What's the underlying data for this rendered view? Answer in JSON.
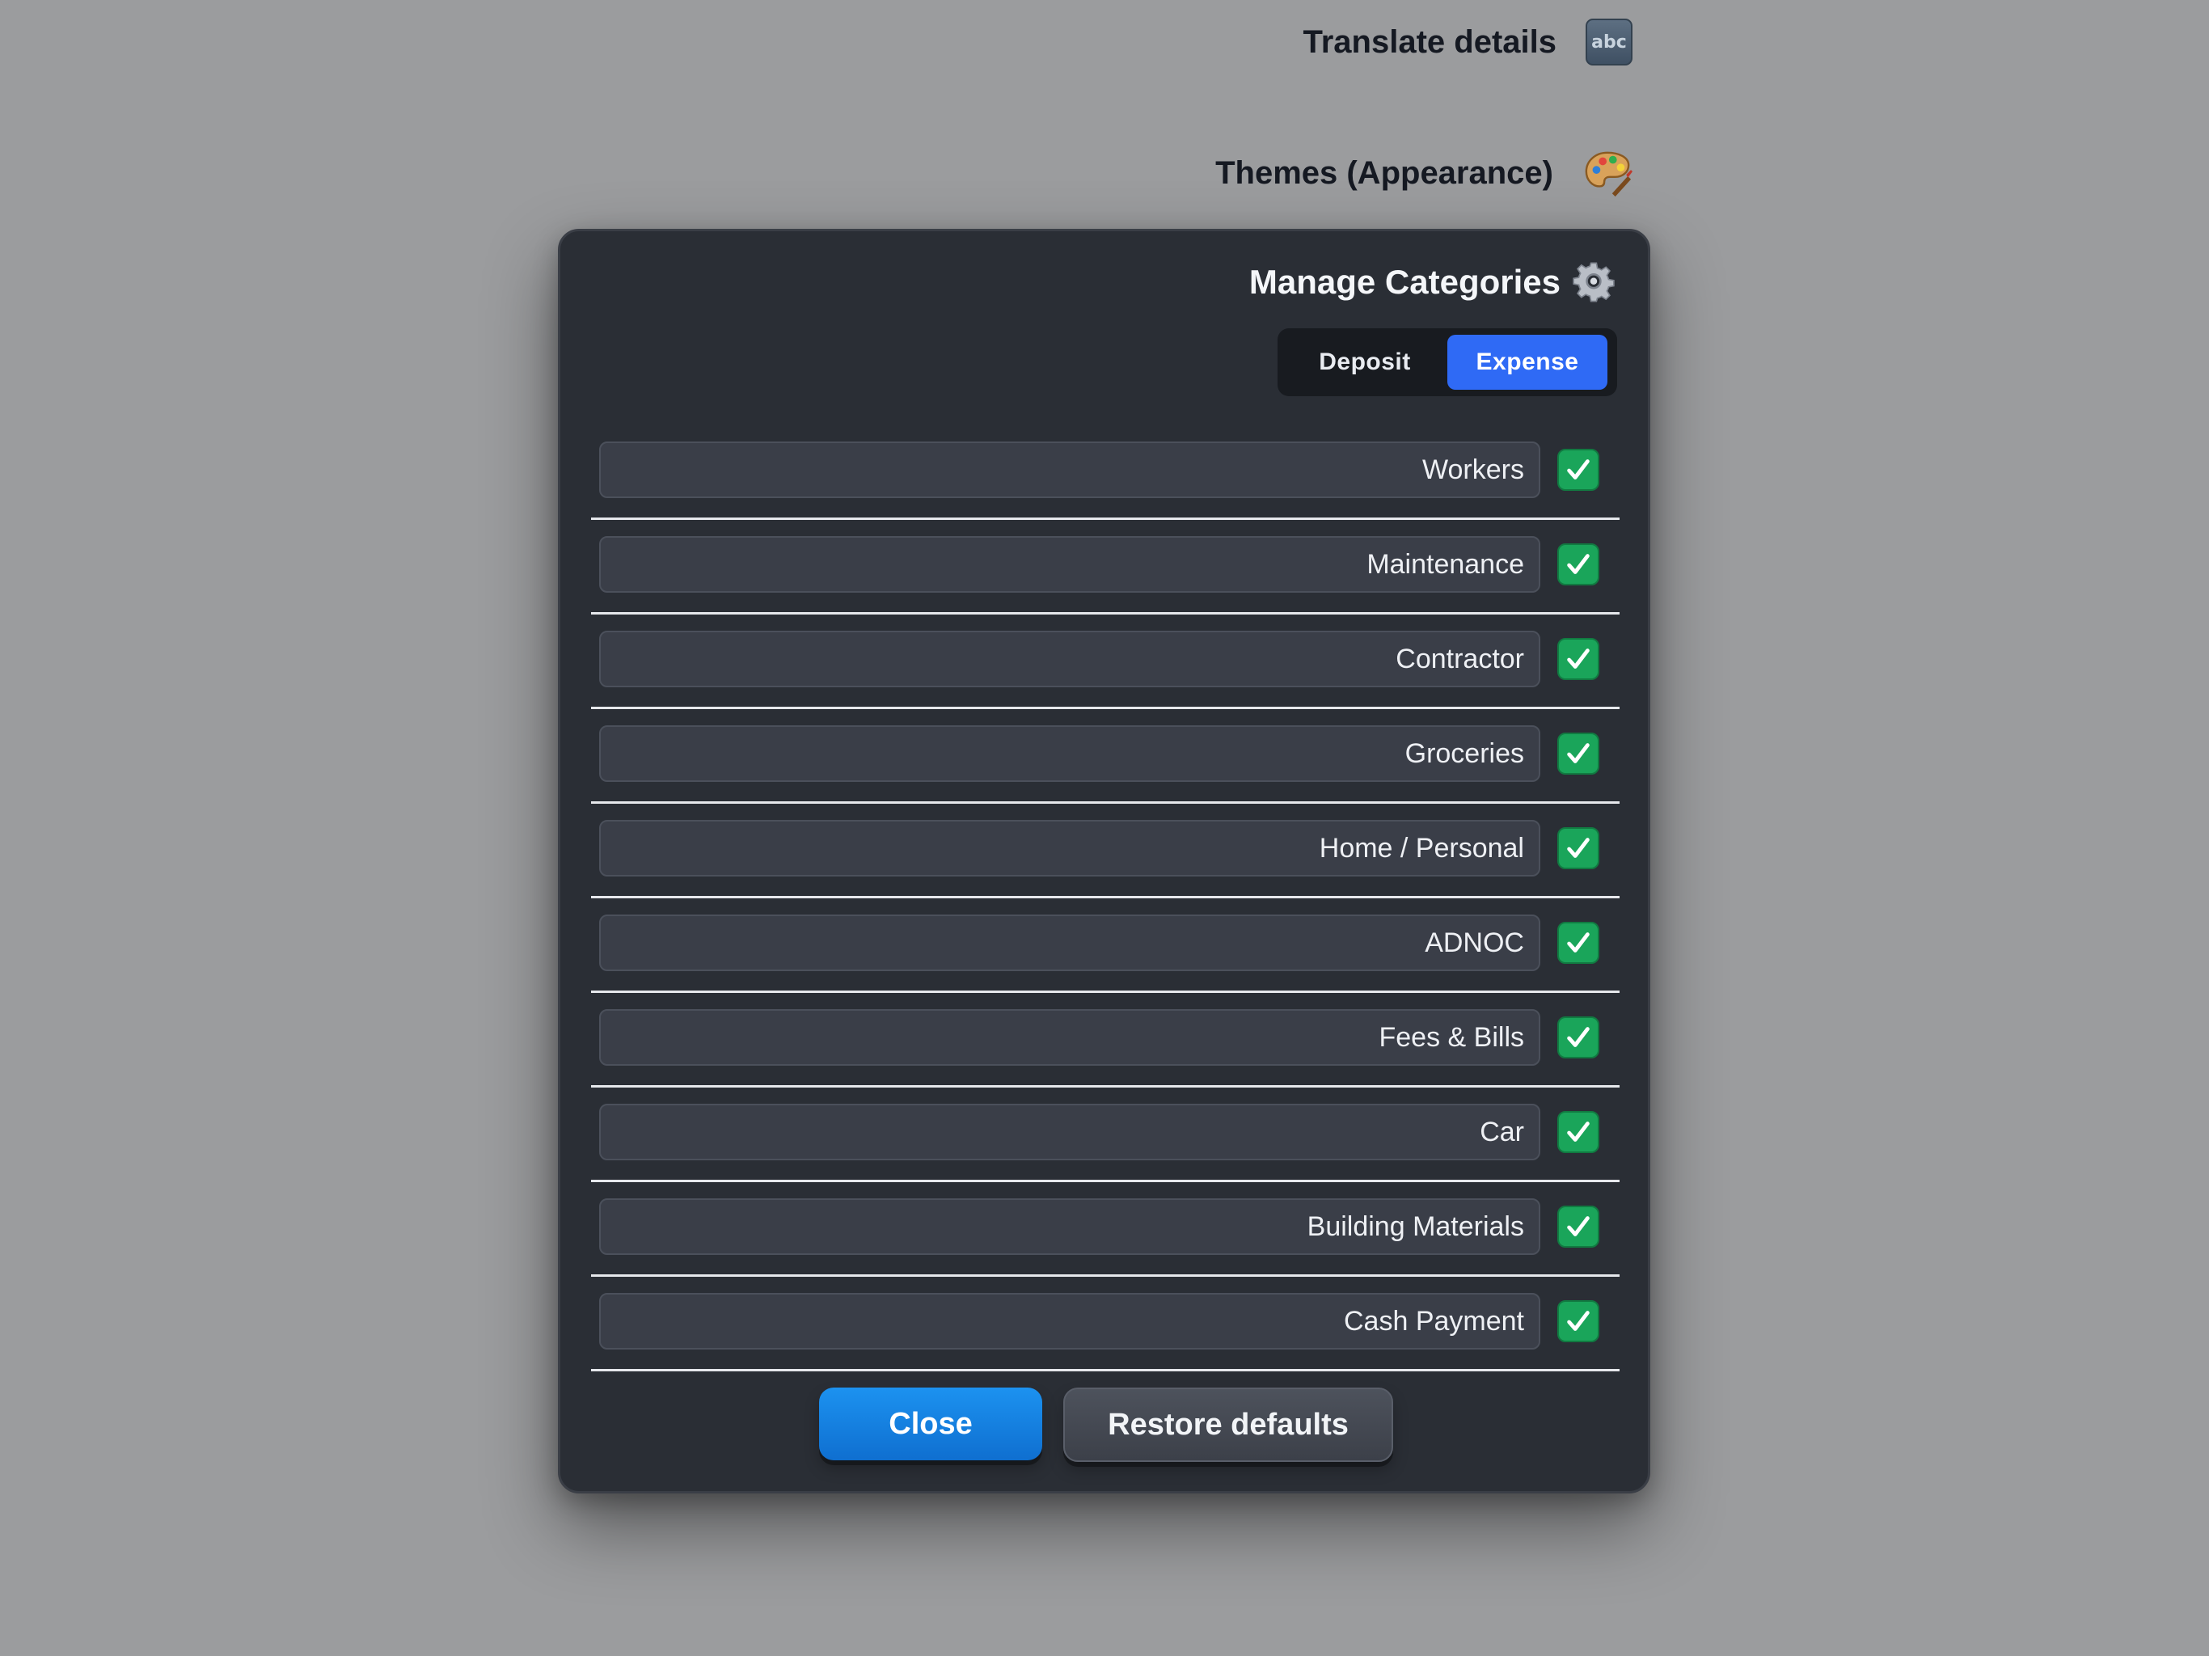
{
  "background": {
    "translate_label": "Translate details",
    "translate_icon": "abc-icon",
    "translate_icon_text": "abc",
    "themes_label": "Themes (Appearance)",
    "themes_icon": "palette-icon"
  },
  "modal": {
    "title": "Manage Categories",
    "title_icon": "gear-icon",
    "tabs": [
      {
        "label": "Deposit",
        "selected": false
      },
      {
        "label": "Expense",
        "selected": true
      }
    ],
    "categories": [
      {
        "name": "Workers",
        "enabled": true
      },
      {
        "name": "Maintenance",
        "enabled": true
      },
      {
        "name": "Contractor",
        "enabled": true
      },
      {
        "name": "Groceries",
        "enabled": true
      },
      {
        "name": "Home / Personal",
        "enabled": true
      },
      {
        "name": "ADNOC",
        "enabled": true
      },
      {
        "name": "Fees & Bills",
        "enabled": true
      },
      {
        "name": "Car",
        "enabled": true
      },
      {
        "name": "Building Materials",
        "enabled": true
      },
      {
        "name": "Cash Payment",
        "enabled": true
      }
    ],
    "close_label": "Close",
    "restore_label": "Restore defaults"
  },
  "colors": {
    "backdrop": "#9b9c9e",
    "modal_bg": "#2a2e35",
    "accent_blue": "#2f6af5",
    "check_green": "#1aa55a",
    "close_button": "#1c92f0"
  }
}
